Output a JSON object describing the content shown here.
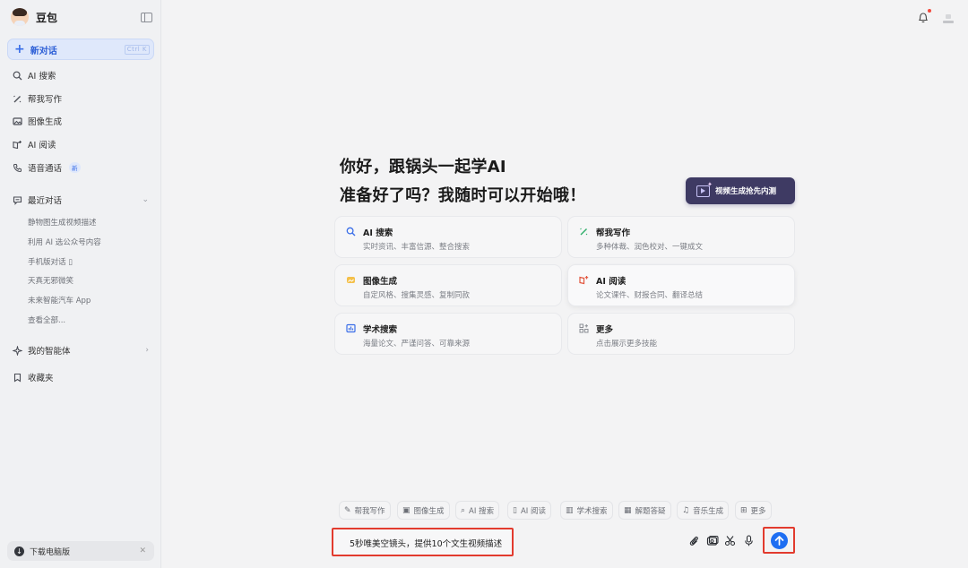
{
  "app": {
    "name": "豆包"
  },
  "sidebar": {
    "new_chat": {
      "label": "新对话",
      "shortcut": "Ctrl K"
    },
    "items": [
      {
        "label": "AI 搜索",
        "icon": "search-sparkle-icon"
      },
      {
        "label": "帮我写作",
        "icon": "pen-icon"
      },
      {
        "label": "图像生成",
        "icon": "image-icon"
      },
      {
        "label": "AI 阅读",
        "icon": "book-icon"
      },
      {
        "label": "语音通话",
        "icon": "phone-icon",
        "badge": "新"
      }
    ],
    "recent": {
      "title": "最近对话",
      "items": [
        "静物图生成视频描述",
        "利用 AI 选公众号内容",
        "手机版对话 ▯",
        "天真无邪微笑",
        "未来智能汽车 App"
      ],
      "view_all": "查看全部..."
    },
    "agents": "我的智能体",
    "favorites": "收藏夹",
    "download": "下载电脑版"
  },
  "main": {
    "greeting_line1": "你好，跟锅头一起学AI",
    "greeting_line2": "准备好了吗？我随时可以开始哦！",
    "promo_label": "视频生成抢先内测",
    "cards": [
      {
        "title": "AI 搜索",
        "desc": "实时资讯、丰富信源、整合搜索",
        "icon": "search-icon",
        "color": "#3a6ee8"
      },
      {
        "title": "帮我写作",
        "desc": "多种体裁、润色校对、一键成文",
        "icon": "pen-icon",
        "color": "#2fae6a"
      },
      {
        "title": "图像生成",
        "desc": "自定风格、搜集灵感、复制同款",
        "icon": "image-icon",
        "color": "#e6a01c"
      },
      {
        "title": "AI 阅读",
        "desc": "论文课件、财报合同、翻译总结",
        "icon": "book-icon",
        "color": "#e2553d"
      },
      {
        "title": "学术搜索",
        "desc": "海量论文、严谨问答、可靠来源",
        "icon": "chart-book-icon",
        "color": "#3a6ee8"
      },
      {
        "title": "更多",
        "desc": "点击展示更多技能",
        "icon": "grid-plus-icon",
        "color": "#8a8d94"
      }
    ]
  },
  "chips": [
    {
      "label": "帮我写作",
      "icon": "pen-icon"
    },
    {
      "label": "图像生成",
      "icon": "image-icon"
    },
    {
      "label": "AI 搜索",
      "icon": "search-icon"
    },
    {
      "label": "AI 阅读",
      "icon": "book-icon"
    },
    {
      "label": "学术搜索",
      "icon": "chart-book-icon"
    },
    {
      "label": "解题答疑",
      "icon": "calculator-icon"
    },
    {
      "label": "音乐生成",
      "icon": "music-icon"
    },
    {
      "label": "更多",
      "icon": "grid-plus-icon"
    }
  ],
  "input": {
    "value": "5秒唯美空镜头，提供10个文生视频描述"
  }
}
